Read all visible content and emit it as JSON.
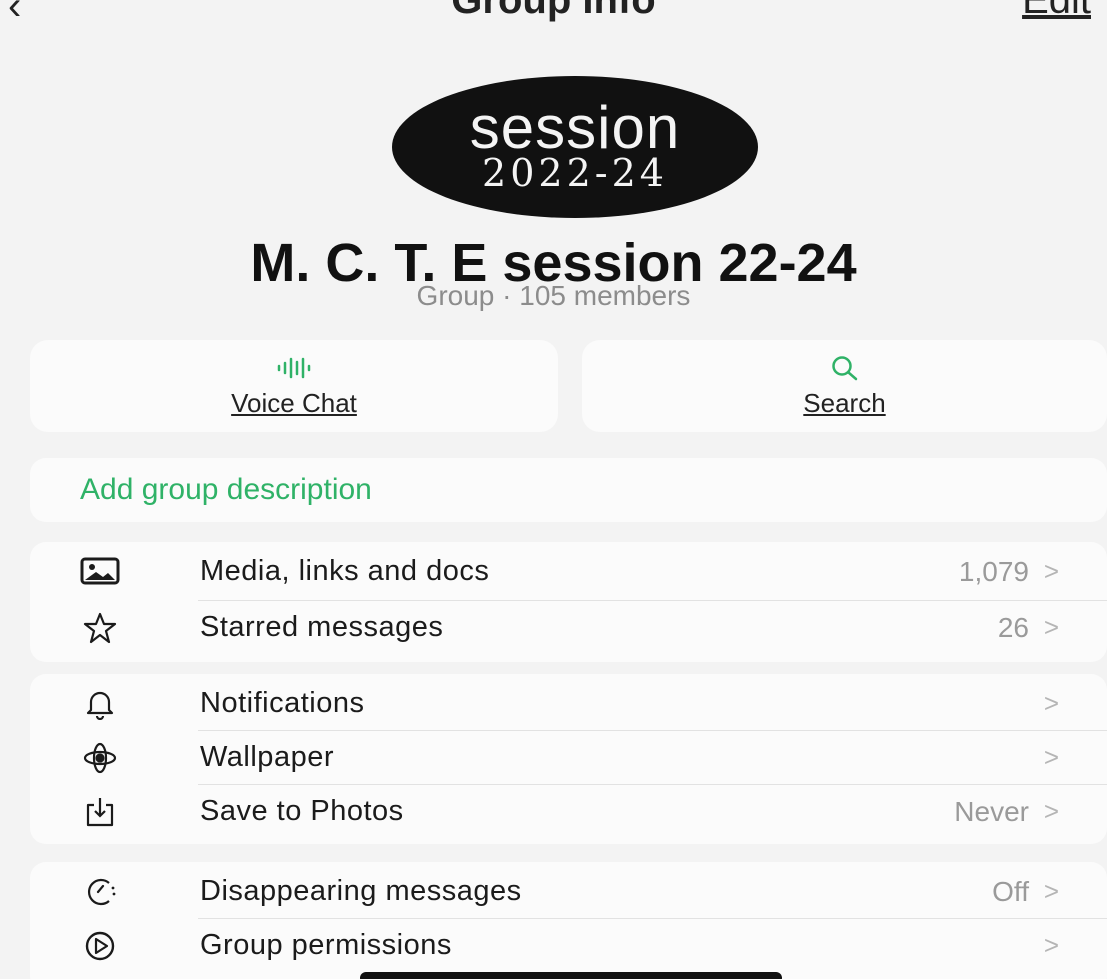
{
  "nav": {
    "back_icon": "chevron-left-icon",
    "title": "Group Info",
    "edit_label": "Edit"
  },
  "avatar": {
    "line1": "session",
    "line2": "2022-24"
  },
  "group": {
    "name": "M. C. T. E session 22-24",
    "subtitle": "Group · 105 members"
  },
  "actions": [
    {
      "label": "Voice Chat",
      "icon": "voice-chat-icon"
    },
    {
      "label": "Search",
      "icon": "search-icon"
    }
  ],
  "description": {
    "label": "Add group description"
  },
  "sections": [
    {
      "items": [
        {
          "label": "Media, links and docs",
          "value": "1,079",
          "icon": "media-icon"
        },
        {
          "label": "Starred messages",
          "value": "26",
          "icon": "star-icon"
        }
      ]
    },
    {
      "items": [
        {
          "label": "Notifications",
          "value": "",
          "icon": "bell-icon"
        },
        {
          "label": "Wallpaper",
          "value": "",
          "icon": "wallpaper-icon"
        },
        {
          "label": "Save to Photos",
          "value": "Never",
          "icon": "save-to-photos-icon"
        }
      ]
    },
    {
      "items": [
        {
          "label": "Disappearing messages",
          "value": "Off",
          "icon": "timer-icon"
        },
        {
          "label": "Group permissions",
          "value": "",
          "icon": "permissions-icon"
        }
      ]
    }
  ],
  "chevron": ">",
  "colors": {
    "accent": "#2fb267",
    "background": "#f3f3f3",
    "card": "#fbfbfb",
    "secondary_text": "#9a9a9a"
  }
}
